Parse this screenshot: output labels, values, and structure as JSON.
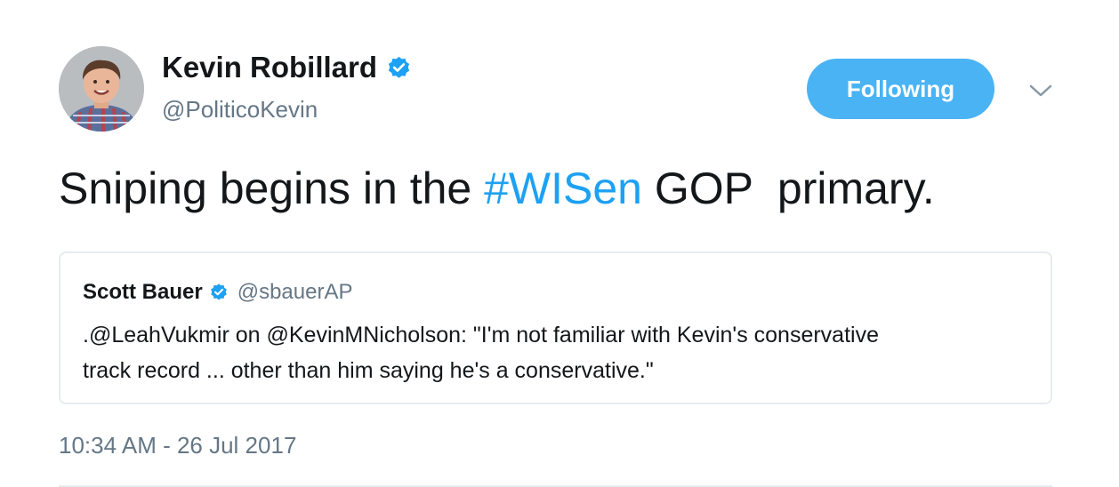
{
  "author": {
    "display_name": "Kevin Robillard",
    "handle": "@PoliticoKevin",
    "verified": true
  },
  "follow_button": {
    "label": "Following",
    "color": "#4ab3f4"
  },
  "tweet": {
    "text_before": "Sniping begins in the ",
    "hashtag": "#WISen",
    "text_after": " GOP  primary.",
    "timestamp": "10:34 AM - 26 Jul 2017"
  },
  "quoted_tweet": {
    "display_name": "Scott Bauer",
    "handle": "@sbauerAP",
    "verified": true,
    "text_line1": ".@LeahVukmir on @KevinMNicholson: \"I'm not familiar with Kevin's conservative",
    "text_line2": "track record ... other than him saying he's a conservative.\""
  },
  "icons": {
    "verified": "verified-badge-icon",
    "caret": "chevron-down-icon"
  },
  "colors": {
    "link": "#1da1f2",
    "secondary_text": "#657786",
    "verified": "#1da1f2"
  }
}
